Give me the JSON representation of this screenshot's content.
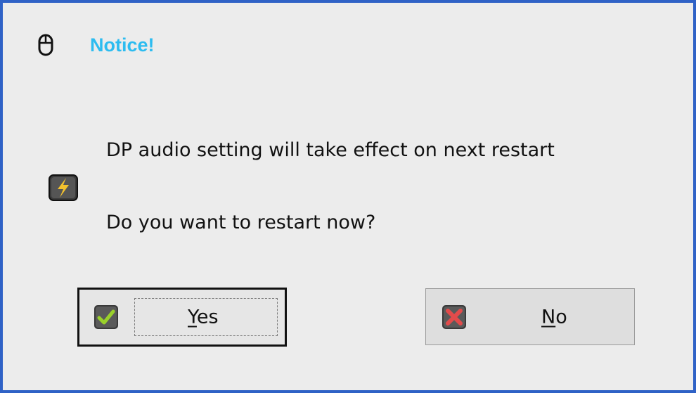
{
  "dialog": {
    "title": "Notice!",
    "message_line1": "DP audio setting will take effect on next restart",
    "message_line2": "Do you want to restart now?",
    "title_icon": "mouse-icon",
    "message_icon": "lightning-warning-icon",
    "colors": {
      "border": "#2f62c6",
      "title": "#2dbcf0",
      "background": "#ececec"
    }
  },
  "buttons": {
    "yes": {
      "mnemonic": "Y",
      "rest": "es",
      "icon": "check-icon",
      "focused": true
    },
    "no": {
      "mnemonic": "N",
      "rest": "o",
      "icon": "x-icon",
      "focused": false
    }
  }
}
